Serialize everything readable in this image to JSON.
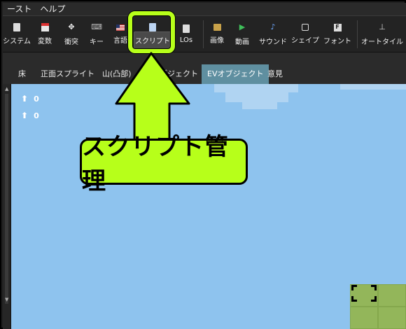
{
  "menu": {
    "items": [
      "ースト",
      "ヘルプ"
    ]
  },
  "toolbar": {
    "buttons": [
      {
        "label": "システム",
        "icon": "system-doc-icon"
      },
      {
        "label": "変数",
        "icon": "variable-icon"
      },
      {
        "label": "衝突",
        "icon": "move-arrows-icon"
      },
      {
        "label": "キー",
        "icon": "gamepad-icon"
      },
      {
        "label": "言語",
        "icon": "flag-icon"
      },
      {
        "label": "スクリプト",
        "icon": "script-icon"
      },
      {
        "label": "LOs",
        "icon": "lo-doc-icon"
      },
      {
        "label": "画像",
        "icon": "image-icon"
      },
      {
        "label": "動画",
        "icon": "play-icon"
      },
      {
        "label": "サウンド",
        "icon": "music-note-icon"
      },
      {
        "label": "シェイプ",
        "icon": "shape-icon"
      },
      {
        "label": "フォント",
        "icon": "font-icon"
      },
      {
        "label": "オートタイル",
        "icon": "autotile-icon"
      }
    ]
  },
  "tabs": [
    {
      "label": "床",
      "active": false
    },
    {
      "label": "正面スプライト",
      "active": false
    },
    {
      "label": "山(凸部)",
      "active": false
    },
    {
      "label": "ブジェクト",
      "active": false
    },
    {
      "label": "EVオブジェクト",
      "active": true
    },
    {
      "label": "意見",
      "active": false
    }
  ],
  "map": {
    "stats": [
      {
        "icon": "up-arrow-icon",
        "value": "0"
      },
      {
        "icon": "up-arrow-plus-icon",
        "value": "0"
      }
    ]
  },
  "annotation": {
    "label": "スクリプト管理",
    "color": "#b7ff1a"
  }
}
